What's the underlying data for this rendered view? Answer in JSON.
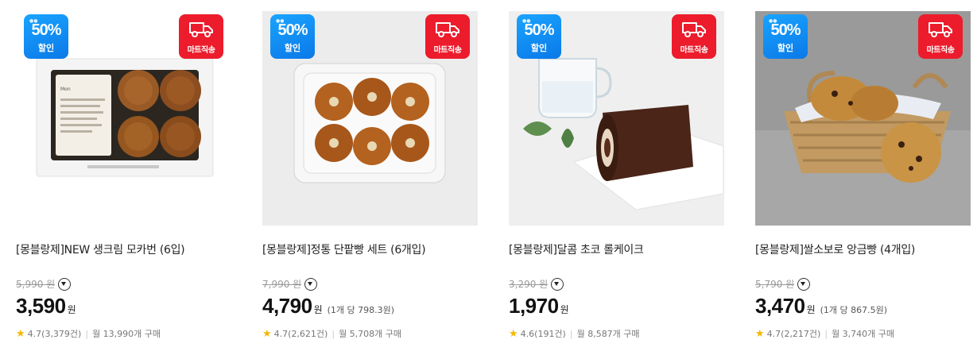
{
  "badges": {
    "sale_pct": "50%",
    "sale_text": "할인",
    "mart_text": "마트직송"
  },
  "won": "원",
  "products": [
    {
      "title": "[몽블랑제]NEW 생크림 모카번 (6입)",
      "original_price": "5,990 원",
      "price": "3,590",
      "unit_price": "",
      "rating": "4.7(3,379건)",
      "purchases": "월 13,990개 구매"
    },
    {
      "title": "[몽블랑제]정통 단팥빵 세트 (6개입)",
      "original_price": "7,990 원",
      "price": "4,790",
      "unit_price": "(1개 당 798.3원)",
      "rating": "4.7(2,621건)",
      "purchases": "월 5,708개 구매"
    },
    {
      "title": "[몽블랑제]달콤 초코 롤케이크",
      "original_price": "3,290 원",
      "price": "1,970",
      "unit_price": "",
      "rating": "4.6(191건)",
      "purchases": "월 8,587개 구매"
    },
    {
      "title": "[몽블랑제]쌀소보로 앙금빵 (4개입)",
      "original_price": "5,790 원",
      "price": "3,470",
      "unit_price": "(1개 당 867.5원)",
      "rating": "4.7(2,217건)",
      "purchases": "월 3,740개 구매"
    }
  ]
}
